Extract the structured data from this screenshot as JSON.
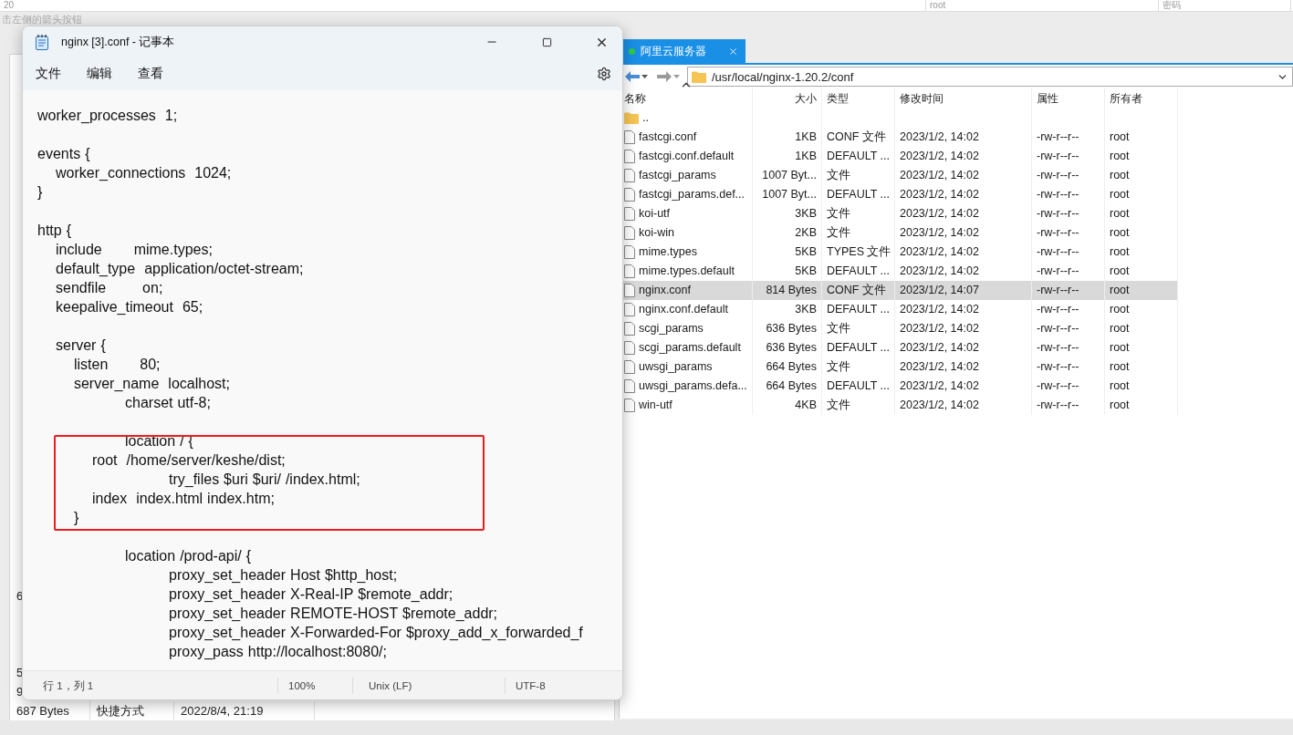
{
  "background_window": {
    "top_fields": [
      "20",
      "root",
      "密码"
    ],
    "hint": "击左侧的箭头按钮",
    "rows": [
      {
        "cells": [
          "6"
        ]
      },
      {
        "cells": [
          "5"
        ]
      },
      {
        "cells": [
          "9"
        ]
      },
      {
        "cells": [
          "687 Bytes",
          "快捷方式",
          "2022/8/4, 21:19"
        ]
      }
    ]
  },
  "notepad": {
    "title": "nginx [3].conf - 记事本",
    "menu": [
      "文件",
      "编辑",
      "查看"
    ],
    "paragraphs": [
      [
        "worker_processes  1;"
      ],
      [
        "events {",
        "    worker_connections  1024;",
        "}"
      ],
      [
        "http {",
        "    include       mime.types;",
        "    default_type  application/octet-stream;",
        "    sendfile        on;",
        "    keepalive_timeout  65;"
      ],
      [
        "    server {",
        "        listen       80;",
        "        server_name  localhost;",
        "\t\tcharset utf-8;"
      ],
      [
        "\t\tlocation / {",
        "            root  /home/server/keshe/dist;",
        "\t\t\ttry_files $uri $uri/ /index.html;",
        "            index  index.html index.htm;",
        "        }"
      ],
      [
        "\t\tlocation /prod-api/ {",
        "\t\t\tproxy_set_header Host $http_host;",
        "\t\t\tproxy_set_header X-Real-IP $remote_addr;",
        "\t\t\tproxy_set_header REMOTE-HOST $remote_addr;",
        "\t\t\tproxy_set_header X-Forwarded-For $proxy_add_x_forwarded_f",
        "\t\t\tproxy_pass http://localhost:8080/;"
      ]
    ],
    "status_bar": {
      "position": "行 1，列 1",
      "zoom": "100%",
      "line_ending": "Unix (LF)",
      "encoding": "UTF-8"
    }
  },
  "file_manager": {
    "tabs": [
      {
        "label": "阿里云服务器",
        "selected": true,
        "connected": true
      }
    ],
    "path": "/usr/local/nginx-1.20.2/conf",
    "columns": [
      {
        "label": "名称",
        "sorted": true
      },
      {
        "label": "大小",
        "sorted": false
      },
      {
        "label": "类型",
        "sorted": false
      },
      {
        "label": "修改时间",
        "sorted": false
      },
      {
        "label": "属性",
        "sorted": false
      },
      {
        "label": "所有者",
        "sorted": false
      }
    ],
    "rows": [
      {
        "kind": "folder",
        "name": "..",
        "selected": false
      },
      {
        "kind": "file",
        "name": "fastcgi.conf",
        "size": "1KB",
        "type": "CONF 文件",
        "modified": "2023/1/2, 14:02",
        "attributes": "-rw-r--r--",
        "owner": "root",
        "selected": false
      },
      {
        "kind": "file",
        "name": "fastcgi.conf.default",
        "size": "1KB",
        "type": "DEFAULT ...",
        "modified": "2023/1/2, 14:02",
        "attributes": "-rw-r--r--",
        "owner": "root",
        "selected": false
      },
      {
        "kind": "file",
        "name": "fastcgi_params",
        "size": "1007 Byt...",
        "type": "文件",
        "modified": "2023/1/2, 14:02",
        "attributes": "-rw-r--r--",
        "owner": "root",
        "selected": false
      },
      {
        "kind": "file",
        "name": "fastcgi_params.def...",
        "size": "1007 Byt...",
        "type": "DEFAULT ...",
        "modified": "2023/1/2, 14:02",
        "attributes": "-rw-r--r--",
        "owner": "root",
        "selected": false
      },
      {
        "kind": "file",
        "name": "koi-utf",
        "size": "3KB",
        "type": "文件",
        "modified": "2023/1/2, 14:02",
        "attributes": "-rw-r--r--",
        "owner": "root",
        "selected": false
      },
      {
        "kind": "file",
        "name": "koi-win",
        "size": "2KB",
        "type": "文件",
        "modified": "2023/1/2, 14:02",
        "attributes": "-rw-r--r--",
        "owner": "root",
        "selected": false
      },
      {
        "kind": "file",
        "name": "mime.types",
        "size": "5KB",
        "type": "TYPES 文件",
        "modified": "2023/1/2, 14:02",
        "attributes": "-rw-r--r--",
        "owner": "root",
        "selected": false
      },
      {
        "kind": "file",
        "name": "mime.types.default",
        "size": "5KB",
        "type": "DEFAULT ...",
        "modified": "2023/1/2, 14:02",
        "attributes": "-rw-r--r--",
        "owner": "root",
        "selected": false
      },
      {
        "kind": "file",
        "name": "nginx.conf",
        "size": "814 Bytes",
        "type": "CONF 文件",
        "modified": "2023/1/2, 14:07",
        "attributes": "-rw-r--r--",
        "owner": "root",
        "selected": true
      },
      {
        "kind": "file",
        "name": "nginx.conf.default",
        "size": "3KB",
        "type": "DEFAULT ...",
        "modified": "2023/1/2, 14:02",
        "attributes": "-rw-r--r--",
        "owner": "root",
        "selected": false
      },
      {
        "kind": "file",
        "name": "scgi_params",
        "size": "636 Bytes",
        "type": "文件",
        "modified": "2023/1/2, 14:02",
        "attributes": "-rw-r--r--",
        "owner": "root",
        "selected": false
      },
      {
        "kind": "file",
        "name": "scgi_params.default",
        "size": "636 Bytes",
        "type": "DEFAULT ...",
        "modified": "2023/1/2, 14:02",
        "attributes": "-rw-r--r--",
        "owner": "root",
        "selected": false
      },
      {
        "kind": "file",
        "name": "uwsgi_params",
        "size": "664 Bytes",
        "type": "文件",
        "modified": "2023/1/2, 14:02",
        "attributes": "-rw-r--r--",
        "owner": "root",
        "selected": false
      },
      {
        "kind": "file",
        "name": "uwsgi_params.defa...",
        "size": "664 Bytes",
        "type": "DEFAULT ...",
        "modified": "2023/1/2, 14:02",
        "attributes": "-rw-r--r--",
        "owner": "root",
        "selected": false
      },
      {
        "kind": "file",
        "name": "win-utf",
        "size": "4KB",
        "type": "文件",
        "modified": "2023/1/2, 14:02",
        "attributes": "-rw-r--r--",
        "owner": "root",
        "selected": false
      }
    ]
  }
}
